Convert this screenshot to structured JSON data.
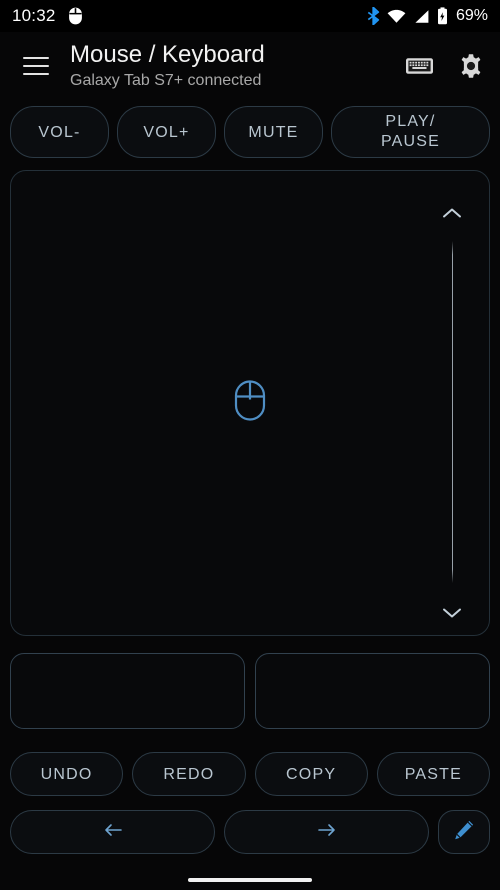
{
  "status_bar": {
    "time": "10:32",
    "battery_percent": "69%",
    "icons": {
      "mouse": "mouse-icon",
      "bluetooth": "bluetooth-icon",
      "wifi": "wifi-icon",
      "signal": "cellular-signal-icon",
      "battery": "battery-icon"
    },
    "colors": {
      "bluetooth": "#2196f3",
      "text": "#ffffff"
    }
  },
  "app_bar": {
    "menu_icon": "hamburger-menu-icon",
    "title": "Mouse / Keyboard",
    "subtitle": "Galaxy Tab S7+ connected",
    "keyboard_icon": "keyboard-icon",
    "settings_icon": "gear-icon"
  },
  "media_buttons": [
    {
      "label": "VOL-",
      "name": "volume-down-button"
    },
    {
      "label": "VOL+",
      "name": "volume-up-button"
    },
    {
      "label": "MUTE",
      "name": "mute-button"
    },
    {
      "label": "PLAY/\nPAUSE",
      "label_line1": "PLAY/",
      "label_line2": "PAUSE",
      "name": "play-pause-button"
    }
  ],
  "touchpad": {
    "center_icon": "mouse-icon",
    "scroll": {
      "up_icon": "chevron-up-icon",
      "down_icon": "chevron-down-icon"
    }
  },
  "click_pads": [
    {
      "label": "",
      "name": "left-click-pad"
    },
    {
      "label": "",
      "name": "right-click-pad"
    }
  ],
  "edit_buttons": [
    {
      "label": "UNDO",
      "name": "undo-button"
    },
    {
      "label": "REDO",
      "name": "redo-button"
    },
    {
      "label": "COPY",
      "name": "copy-button"
    },
    {
      "label": "PASTE",
      "name": "paste-button"
    }
  ],
  "bottom_row": {
    "back_icon": "arrow-left-icon",
    "forward_icon": "arrow-right-icon",
    "edit_icon": "pencil-icon"
  },
  "theme": {
    "background": "#060607",
    "accent": "#5b9bd5",
    "button_text": "#b9c6d0",
    "button_border": "#2c3a45",
    "title_text": "#f2f2f2",
    "subtitle_text": "#a8a8a8"
  },
  "navigation": {
    "gesture_bar": "home-gesture-bar"
  }
}
